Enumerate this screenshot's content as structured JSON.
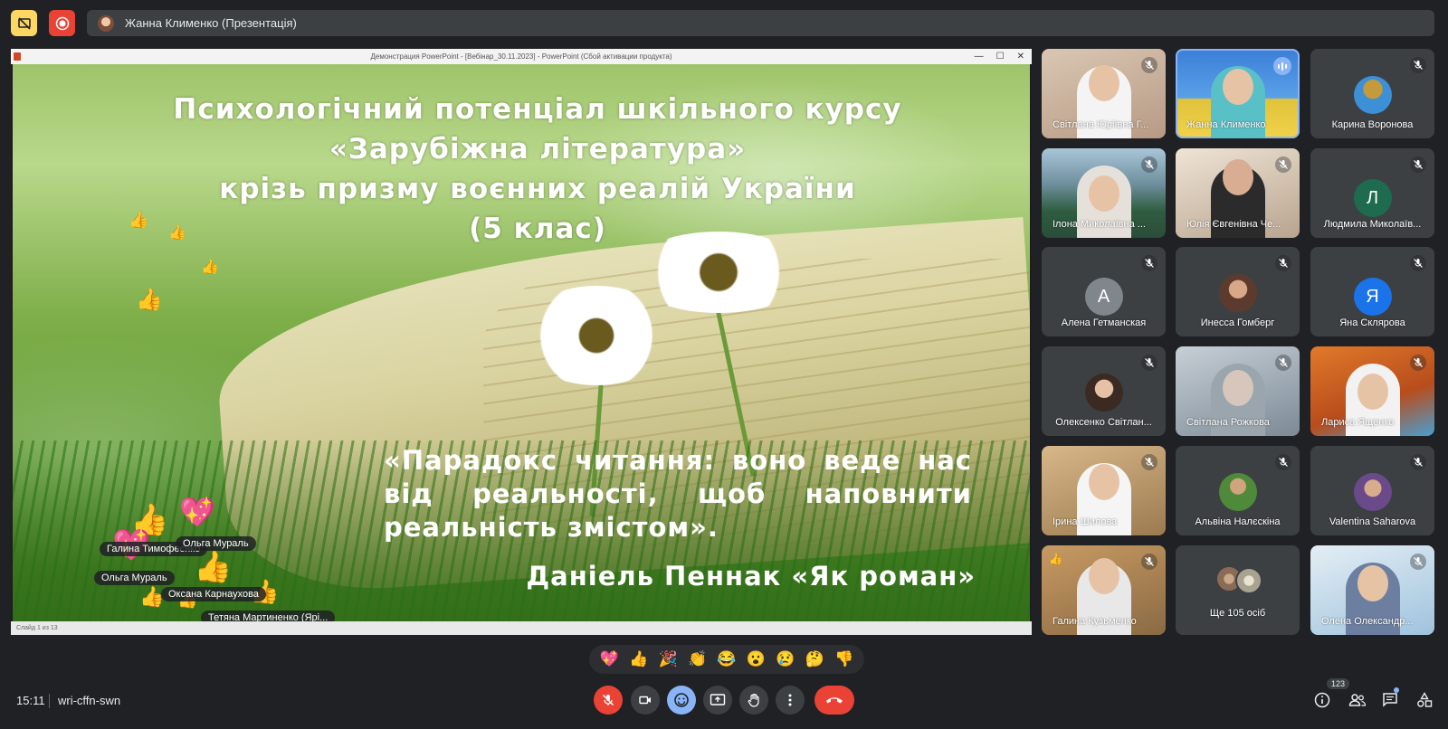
{
  "top": {
    "presenter_label": "Жанна Клименко (Презентація)"
  },
  "presentation": {
    "window_title": "Демонстрация PowerPoint - [Вебінар_30.11.2023] - PowerPoint (Сбой активации продукта)",
    "title_lines": [
      "Психологічний потенціал шкільного курсу",
      "«Зарубіжна література»",
      "крізь призму воєнних реалій України",
      "(5 клас)"
    ],
    "quote_lines": [
      "«Парадокс читання: воно веде нас",
      "від реальності, щоб наповнити",
      "реальність змістом»."
    ],
    "author": "Даніель Пеннак «Як роман»",
    "status_text": "Слайд 1 из 13",
    "reaction_names": [
      "Галина Тимофеєнко",
      "Ольга Мураль",
      "Ольга Мураль",
      "Оксана Карнаухова",
      "Тетяна Мартиненко (Ярі..."
    ]
  },
  "participants": [
    {
      "name": "Світлана Юріївна Г...",
      "kind": "video",
      "muted": true
    },
    {
      "name": "Жанна Клименко",
      "kind": "video",
      "muted": false,
      "speaking": true
    },
    {
      "name": "Карина Воронова",
      "kind": "photo",
      "muted": true
    },
    {
      "name": "Ілона Миколаївна ...",
      "kind": "video",
      "muted": true
    },
    {
      "name": "Юлія Євгенівна Че...",
      "kind": "video",
      "muted": true
    },
    {
      "name": "Людмила Миколаїв...",
      "kind": "letter",
      "letter": "Л",
      "color": "#1e6b4f",
      "muted": true
    },
    {
      "name": "Алена Гетманская",
      "kind": "letter",
      "letter": "А",
      "color": "#7f868c",
      "muted": true
    },
    {
      "name": "Инесса Гомберг",
      "kind": "photo",
      "muted": true
    },
    {
      "name": "Яна Склярова",
      "kind": "letter",
      "letter": "Я",
      "color": "#1a73e8",
      "muted": true
    },
    {
      "name": "Олексенко Світлан...",
      "kind": "photo",
      "muted": true
    },
    {
      "name": "Світлана Рожкова",
      "kind": "video",
      "muted": true
    },
    {
      "name": "Лариса Ященко",
      "kind": "video",
      "muted": true
    },
    {
      "name": "Ірина Шилова",
      "kind": "video",
      "muted": true
    },
    {
      "name": "Альвіна Налєскіна",
      "kind": "photo",
      "muted": true
    },
    {
      "name": "Valentina Saharova",
      "kind": "photo",
      "muted": true
    },
    {
      "name": "Галина Кузьменко",
      "kind": "video",
      "muted": true
    },
    {
      "name": "Ще 105 осіб",
      "kind": "more",
      "muted": false
    },
    {
      "name": "Олена Олександр...",
      "kind": "video",
      "muted": true
    }
  ],
  "reactions": [
    "💖",
    "👍",
    "🎉",
    "👏",
    "😂",
    "😮",
    "😢",
    "🤔",
    "👎"
  ],
  "bottom": {
    "time": "15:11",
    "meeting_code": "wri-cffn-swn",
    "participant_count": "123"
  },
  "colors": {
    "background": "#202124",
    "tile": "#3c4043",
    "danger": "#ea4335",
    "accent": "#8ab4f8",
    "warning": "#fdd663"
  }
}
